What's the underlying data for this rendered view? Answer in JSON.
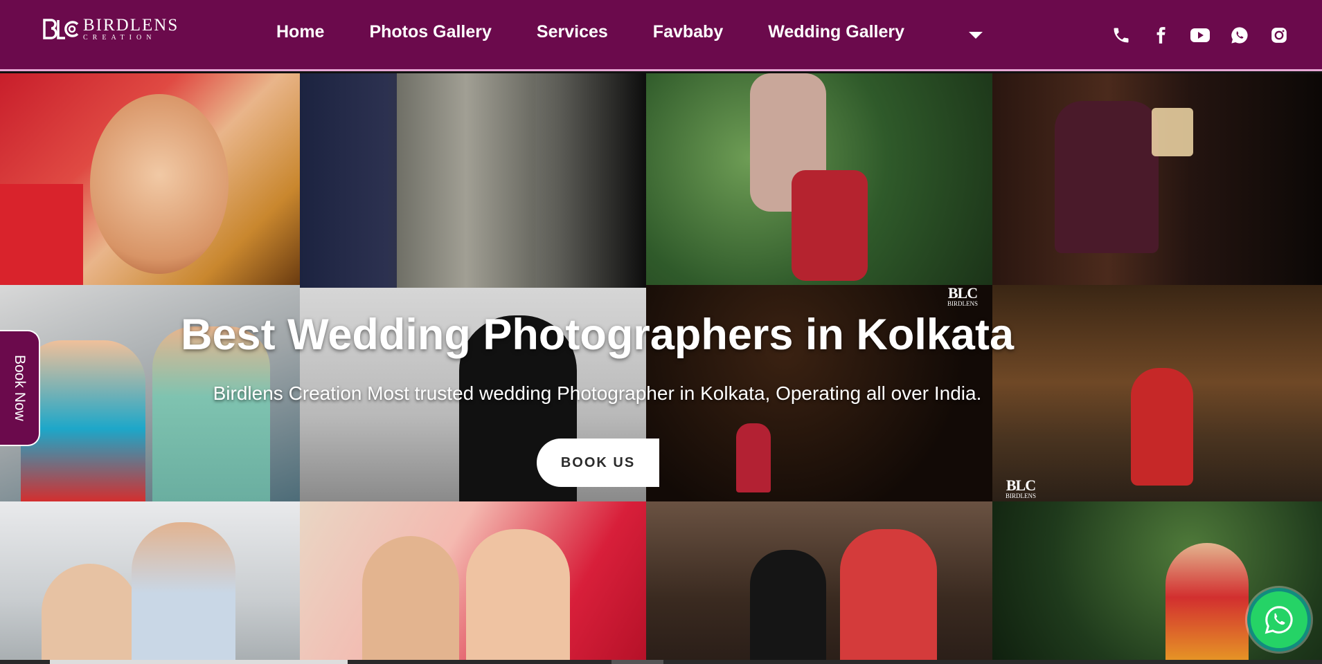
{
  "brand": {
    "name": "BIRDLENS",
    "sub": "CREATION",
    "color": "#6b0a4c"
  },
  "nav": {
    "items": [
      "Home",
      "Photos Gallery",
      "Services",
      "Favbaby",
      "Wedding Gallery"
    ],
    "more_icon": "chevron-down-icon"
  },
  "social": [
    "phone-icon",
    "facebook-icon",
    "youtube-icon",
    "whatsapp-icon",
    "instagram-icon"
  ],
  "hero": {
    "title": "Best Wedding Photographers in Kolkata",
    "subtitle": "Birdlens Creation Most trusted wedding Photographer in Kolkata, Operating all over India.",
    "cta": "BOOK US"
  },
  "side_tab": {
    "label": "Book Now"
  },
  "floating_button": {
    "icon": "whatsapp-icon",
    "color": "#25d366"
  },
  "watermark": {
    "mark": "BLC",
    "text": "BIRDLENS"
  }
}
